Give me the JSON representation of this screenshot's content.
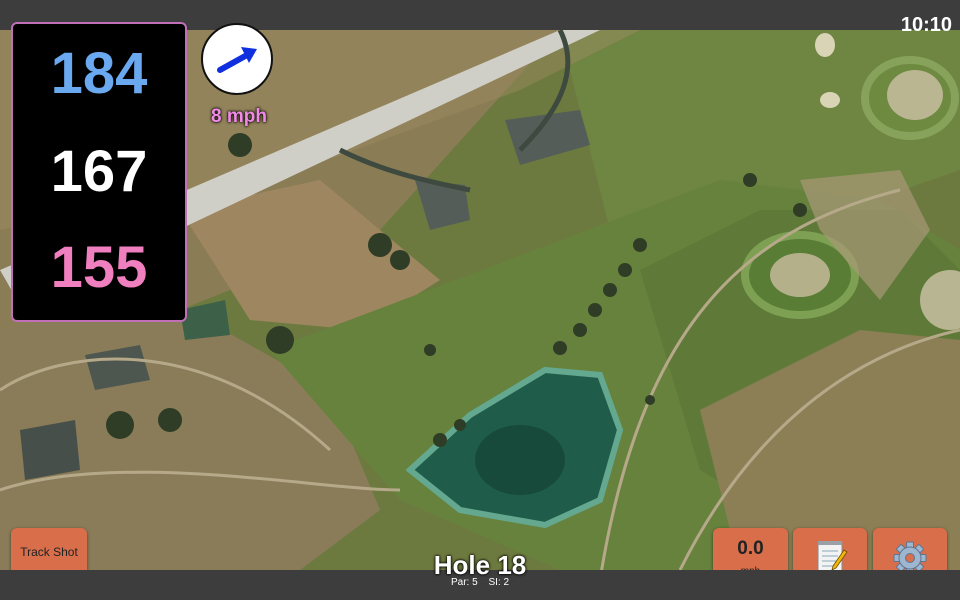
{
  "status": {
    "time": "10:10"
  },
  "distances": {
    "back": "184",
    "middle": "167",
    "front": "155"
  },
  "wind": {
    "speed": "8 mph",
    "icon": "wind-arrow-icon"
  },
  "buttons": {
    "track_shot": "Track Shot",
    "speed_value": "0.0",
    "speed_unit": "mph",
    "notes_icon": "notepad-icon",
    "settings_icon": "gear-icon"
  },
  "hole": {
    "title": "Hole 18",
    "par": "Par: 5",
    "si": "SI: 2"
  },
  "colors": {
    "back": "#6aa8f0",
    "middle": "#ffffff",
    "front": "#f07fc0",
    "button": "#d86e4a",
    "wind_text": "#f08ae6"
  }
}
